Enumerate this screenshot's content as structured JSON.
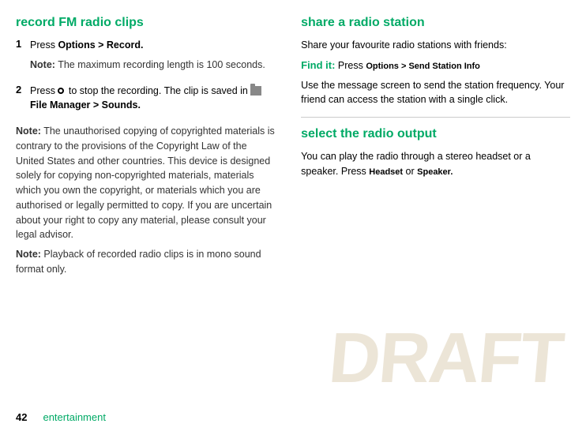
{
  "left": {
    "section_title": "record FM radio clips",
    "step1": {
      "number": "1",
      "text_before": "Press ",
      "options_text": "Options > Record.",
      "note_label": "Note:",
      "note_text": " The maximum recording length is 100 seconds."
    },
    "step2": {
      "number": "2",
      "text_before": "Press ",
      "bullet_desc": " to stop the recording. The clip is saved in ",
      "file_manager": "File Manager > Sounds."
    },
    "note1_label": "Note:",
    "note1_text": " The unauthorised copying of copyrighted materials is contrary to the provisions of the Copyright Law of the United States and other countries. This device is designed solely for copying non-copyrighted materials, materials which you own the copyright, or materials which you are authorised or legally permitted to copy. If you are uncertain about your right to copy any material, please consult your legal advisor.",
    "note2_label": "Note:",
    "note2_text": " Playback of recorded radio clips is in mono sound format only."
  },
  "right": {
    "section1_title": "share a radio station",
    "section1_intro": "Share your favourite radio stations with friends:",
    "find_it_label": "Find it:",
    "find_it_text": " Press ",
    "find_it_code": "Options > Send Station Info",
    "section1_body": "Use the message screen to send the station frequency. Your friend can access the station with a single click.",
    "section2_title": "select the radio output",
    "section2_body": "You can play the radio through a stereo headset or a speaker. Press ",
    "section2_code1": "Headset",
    "section2_or": " or ",
    "section2_code2": "Speaker."
  },
  "footer": {
    "page_number": "42",
    "label": "entertainment"
  },
  "draft_watermark": "DRAFT"
}
